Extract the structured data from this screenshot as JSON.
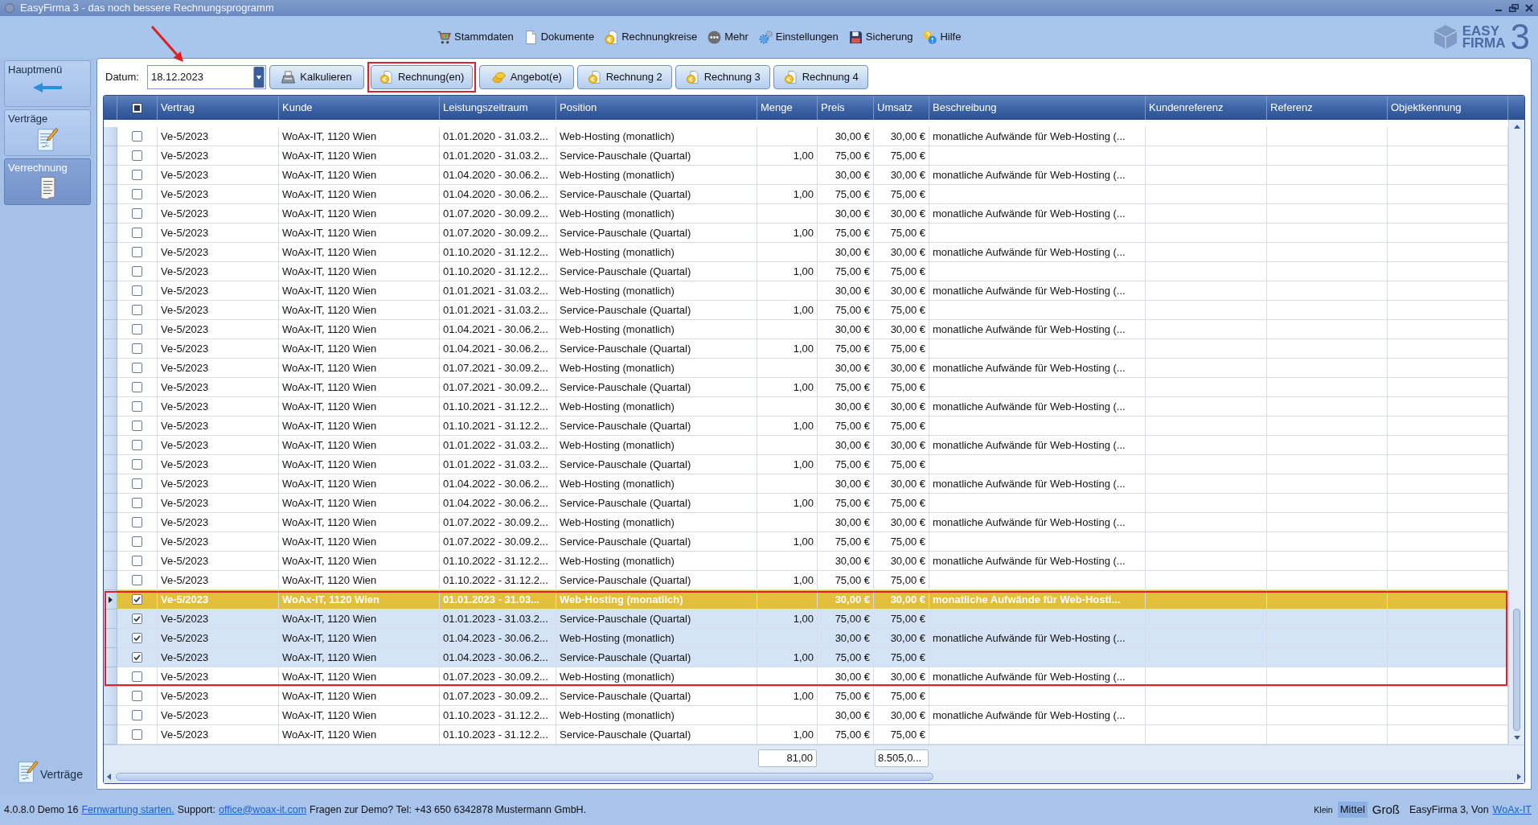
{
  "window": {
    "title": "EasyFirma 3 - das noch bessere Rechnungsprogramm"
  },
  "menu": [
    {
      "label": "Stammdaten"
    },
    {
      "label": "Dokumente"
    },
    {
      "label": "Rechnungkreise"
    },
    {
      "label": "Mehr"
    },
    {
      "label": "Einstellungen"
    },
    {
      "label": "Sicherung"
    },
    {
      "label": "Hilfe"
    }
  ],
  "logo": {
    "line1": "EASY",
    "line2": "FIRMA",
    "numeral": "3"
  },
  "sidebar": {
    "items": [
      {
        "label": "Hauptmenü",
        "selected": false
      },
      {
        "label": "Verträge",
        "selected": false
      },
      {
        "label": "Verrechnung",
        "selected": true
      }
    ],
    "footer_link": "Verträge"
  },
  "toolbar": {
    "date": {
      "label": "Datum:",
      "value": "18.12.2023",
      "marked": true
    },
    "buttons": [
      {
        "label": "Kalkulieren",
        "kind": "calculate",
        "marked": false
      },
      {
        "label": "Rechnung(en)",
        "kind": "invoice",
        "marked": true
      },
      {
        "label": "Angebot(e)",
        "kind": "quote",
        "marked": false
      },
      {
        "label": "Rechnung 2",
        "kind": "invoice",
        "marked": false
      },
      {
        "label": "Rechnung 3",
        "kind": "invoice",
        "marked": false
      },
      {
        "label": "Rechnung 4",
        "kind": "invoice",
        "marked": false
      }
    ]
  },
  "table": {
    "header_checkbox": {
      "indeterminate": true
    },
    "columns": [
      "Vertrag",
      "Kunde",
      "Leistungszeitraum",
      "Position",
      "Menge",
      "Preis",
      "Umsatz",
      "Beschreibung",
      "Kundenreferenz",
      "Referenz",
      "Objektkennung"
    ],
    "row_groups": [
      {
        "highlighted": false,
        "rows": [
          {
            "vertrag": "Ve-5/2023",
            "kunde": "WoAx-IT, 1120 Wien",
            "leistungszeitraum": "01.01.2020 - 31.03.2...",
            "position": "Web-Hosting (monatlich)",
            "preis": "30,00 €",
            "umsatz": "30,00 €",
            "beschreibung": "monatliche Aufwände für Web-Hosting (...",
            "checked": false,
            "selected": false,
            "focused": false
          },
          {
            "vertrag": "Ve-5/2023",
            "kunde": "WoAx-IT, 1120 Wien",
            "leistungszeitraum": "01.01.2020 - 31.03.2...",
            "position": "Service-Pauschale (Quartal)",
            "menge": "1,00",
            "preis": "75,00 €",
            "umsatz": "75,00 €",
            "checked": false,
            "selected": false,
            "focused": false
          },
          {
            "vertrag": "Ve-5/2023",
            "kunde": "WoAx-IT, 1120 Wien",
            "leistungszeitraum": "01.04.2020 - 30.06.2...",
            "position": "Web-Hosting (monatlich)",
            "preis": "30,00 €",
            "umsatz": "30,00 €",
            "beschreibung": "monatliche Aufwände für Web-Hosting (...",
            "checked": false,
            "selected": false,
            "focused": false
          },
          {
            "vertrag": "Ve-5/2023",
            "kunde": "WoAx-IT, 1120 Wien",
            "leistungszeitraum": "01.04.2020 - 30.06.2...",
            "position": "Service-Pauschale (Quartal)",
            "menge": "1,00",
            "preis": "75,00 €",
            "umsatz": "75,00 €",
            "checked": false,
            "selected": false,
            "focused": false
          },
          {
            "vertrag": "Ve-5/2023",
            "kunde": "WoAx-IT, 1120 Wien",
            "leistungszeitraum": "01.07.2020 - 30.09.2...",
            "position": "Web-Hosting (monatlich)",
            "preis": "30,00 €",
            "umsatz": "30,00 €",
            "beschreibung": "monatliche Aufwände für Web-Hosting (...",
            "checked": false,
            "selected": false,
            "focused": false
          },
          {
            "vertrag": "Ve-5/2023",
            "kunde": "WoAx-IT, 1120 Wien",
            "leistungszeitraum": "01.07.2020 - 30.09.2...",
            "position": "Service-Pauschale (Quartal)",
            "menge": "1,00",
            "preis": "75,00 €",
            "umsatz": "75,00 €",
            "checked": false,
            "selected": false,
            "focused": false
          },
          {
            "vertrag": "Ve-5/2023",
            "kunde": "WoAx-IT, 1120 Wien",
            "leistungszeitraum": "01.10.2020 - 31.12.2...",
            "position": "Web-Hosting (monatlich)",
            "preis": "30,00 €",
            "umsatz": "30,00 €",
            "beschreibung": "monatliche Aufwände für Web-Hosting (...",
            "checked": false,
            "selected": false,
            "focused": false
          },
          {
            "vertrag": "Ve-5/2023",
            "kunde": "WoAx-IT, 1120 Wien",
            "leistungszeitraum": "01.10.2020 - 31.12.2...",
            "position": "Service-Pauschale (Quartal)",
            "menge": "1,00",
            "preis": "75,00 €",
            "umsatz": "75,00 €",
            "checked": false,
            "selected": false,
            "focused": false
          },
          {
            "vertrag": "Ve-5/2023",
            "kunde": "WoAx-IT, 1120 Wien",
            "leistungszeitraum": "01.01.2021 - 31.03.2...",
            "position": "Web-Hosting (monatlich)",
            "preis": "30,00 €",
            "umsatz": "30,00 €",
            "beschreibung": "monatliche Aufwände für Web-Hosting (...",
            "checked": false,
            "selected": false,
            "focused": false
          },
          {
            "vertrag": "Ve-5/2023",
            "kunde": "WoAx-IT, 1120 Wien",
            "leistungszeitraum": "01.01.2021 - 31.03.2...",
            "position": "Service-Pauschale (Quartal)",
            "menge": "1,00",
            "preis": "75,00 €",
            "umsatz": "75,00 €",
            "checked": false,
            "selected": false,
            "focused": false
          },
          {
            "vertrag": "Ve-5/2023",
            "kunde": "WoAx-IT, 1120 Wien",
            "leistungszeitraum": "01.04.2021 - 30.06.2...",
            "position": "Web-Hosting (monatlich)",
            "preis": "30,00 €",
            "umsatz": "30,00 €",
            "beschreibung": "monatliche Aufwände für Web-Hosting (...",
            "checked": false,
            "selected": false,
            "focused": false
          },
          {
            "vertrag": "Ve-5/2023",
            "kunde": "WoAx-IT, 1120 Wien",
            "leistungszeitraum": "01.04.2021 - 30.06.2...",
            "position": "Service-Pauschale (Quartal)",
            "menge": "1,00",
            "preis": "75,00 €",
            "umsatz": "75,00 €",
            "checked": false,
            "selected": false,
            "focused": false
          },
          {
            "vertrag": "Ve-5/2023",
            "kunde": "WoAx-IT, 1120 Wien",
            "leistungszeitraum": "01.07.2021 - 30.09.2...",
            "position": "Web-Hosting (monatlich)",
            "preis": "30,00 €",
            "umsatz": "30,00 €",
            "beschreibung": "monatliche Aufwände für Web-Hosting (...",
            "checked": false,
            "selected": false,
            "focused": false
          },
          {
            "vertrag": "Ve-5/2023",
            "kunde": "WoAx-IT, 1120 Wien",
            "leistungszeitraum": "01.07.2021 - 30.09.2...",
            "position": "Service-Pauschale (Quartal)",
            "menge": "1,00",
            "preis": "75,00 €",
            "umsatz": "75,00 €",
            "checked": false,
            "selected": false,
            "focused": false
          },
          {
            "vertrag": "Ve-5/2023",
            "kunde": "WoAx-IT, 1120 Wien",
            "leistungszeitraum": "01.10.2021 - 31.12.2...",
            "position": "Web-Hosting (monatlich)",
            "preis": "30,00 €",
            "umsatz": "30,00 €",
            "beschreibung": "monatliche Aufwände für Web-Hosting (...",
            "checked": false,
            "selected": false,
            "focused": false
          },
          {
            "vertrag": "Ve-5/2023",
            "kunde": "WoAx-IT, 1120 Wien",
            "leistungszeitraum": "01.10.2021 - 31.12.2...",
            "position": "Service-Pauschale (Quartal)",
            "menge": "1,00",
            "preis": "75,00 €",
            "umsatz": "75,00 €",
            "checked": false,
            "selected": false,
            "focused": false
          },
          {
            "vertrag": "Ve-5/2023",
            "kunde": "WoAx-IT, 1120 Wien",
            "leistungszeitraum": "01.01.2022 - 31.03.2...",
            "position": "Web-Hosting (monatlich)",
            "preis": "30,00 €",
            "umsatz": "30,00 €",
            "beschreibung": "monatliche Aufwände für Web-Hosting (...",
            "checked": false,
            "selected": false,
            "focused": false
          },
          {
            "vertrag": "Ve-5/2023",
            "kunde": "WoAx-IT, 1120 Wien",
            "leistungszeitraum": "01.01.2022 - 31.03.2...",
            "position": "Service-Pauschale (Quartal)",
            "menge": "1,00",
            "preis": "75,00 €",
            "umsatz": "75,00 €",
            "checked": false,
            "selected": false,
            "focused": false
          },
          {
            "vertrag": "Ve-5/2023",
            "kunde": "WoAx-IT, 1120 Wien",
            "leistungszeitraum": "01.04.2022 - 30.06.2...",
            "position": "Web-Hosting (monatlich)",
            "preis": "30,00 €",
            "umsatz": "30,00 €",
            "beschreibung": "monatliche Aufwände für Web-Hosting (...",
            "checked": false,
            "selected": false,
            "focused": false
          },
          {
            "vertrag": "Ve-5/2023",
            "kunde": "WoAx-IT, 1120 Wien",
            "leistungszeitraum": "01.04.2022 - 30.06.2...",
            "position": "Service-Pauschale (Quartal)",
            "menge": "1,00",
            "preis": "75,00 €",
            "umsatz": "75,00 €",
            "checked": false,
            "selected": false,
            "focused": false
          },
          {
            "vertrag": "Ve-5/2023",
            "kunde": "WoAx-IT, 1120 Wien",
            "leistungszeitraum": "01.07.2022 - 30.09.2...",
            "position": "Web-Hosting (monatlich)",
            "preis": "30,00 €",
            "umsatz": "30,00 €",
            "beschreibung": "monatliche Aufwände für Web-Hosting (...",
            "checked": false,
            "selected": false,
            "focused": false
          },
          {
            "vertrag": "Ve-5/2023",
            "kunde": "WoAx-IT, 1120 Wien",
            "leistungszeitraum": "01.07.2022 - 30.09.2...",
            "position": "Service-Pauschale (Quartal)",
            "menge": "1,00",
            "preis": "75,00 €",
            "umsatz": "75,00 €",
            "checked": false,
            "selected": false,
            "focused": false
          },
          {
            "vertrag": "Ve-5/2023",
            "kunde": "WoAx-IT, 1120 Wien",
            "leistungszeitraum": "01.10.2022 - 31.12.2...",
            "position": "Web-Hosting (monatlich)",
            "preis": "30,00 €",
            "umsatz": "30,00 €",
            "beschreibung": "monatliche Aufwände für Web-Hosting (...",
            "checked": false,
            "selected": false,
            "focused": false
          },
          {
            "vertrag": "Ve-5/2023",
            "kunde": "WoAx-IT, 1120 Wien",
            "leistungszeitraum": "01.10.2022 - 31.12.2...",
            "position": "Service-Pauschale (Quartal)",
            "menge": "1,00",
            "preis": "75,00 €",
            "umsatz": "75,00 €",
            "checked": false,
            "selected": false,
            "focused": false
          }
        ]
      },
      {
        "highlighted": true,
        "rows": [
          {
            "vertrag": "Ve-5/2023",
            "kunde": "WoAx-IT, 1120 Wien",
            "leistungszeitraum": "01.01.2023 - 31.03...",
            "position": "Web-Hosting (monatlich)",
            "preis": "30,00 €",
            "umsatz": "30,00 €",
            "beschreibung": "monatliche Aufwände für Web-Hosti...",
            "checked": true,
            "selected": true,
            "focused": true
          },
          {
            "vertrag": "Ve-5/2023",
            "kunde": "WoAx-IT, 1120 Wien",
            "leistungszeitraum": "01.01.2023 - 31.03.2...",
            "position": "Service-Pauschale (Quartal)",
            "menge": "1,00",
            "preis": "75,00 €",
            "umsatz": "75,00 €",
            "checked": true,
            "selected": true,
            "focused": false
          },
          {
            "vertrag": "Ve-5/2023",
            "kunde": "WoAx-IT, 1120 Wien",
            "leistungszeitraum": "01.04.2023 - 30.06.2...",
            "position": "Web-Hosting (monatlich)",
            "preis": "30,00 €",
            "umsatz": "30,00 €",
            "beschreibung": "monatliche Aufwände für Web-Hosting (...",
            "checked": true,
            "selected": true,
            "focused": false
          },
          {
            "vertrag": "Ve-5/2023",
            "kunde": "WoAx-IT, 1120 Wien",
            "leistungszeitraum": "01.04.2023 - 30.06.2...",
            "position": "Service-Pauschale (Quartal)",
            "menge": "1,00",
            "preis": "75,00 €",
            "umsatz": "75,00 €",
            "checked": true,
            "selected": true,
            "focused": false
          },
          {
            "vertrag": "Ve-5/2023",
            "kunde": "WoAx-IT, 1120 Wien",
            "leistungszeitraum": "01.07.2023 - 30.09.2...",
            "position": "Web-Hosting (monatlich)",
            "preis": "30,00 €",
            "umsatz": "30,00 €",
            "beschreibung": "monatliche Aufwände für Web-Hosting (...",
            "checked": false,
            "selected": false,
            "focused": false
          }
        ]
      },
      {
        "highlighted": false,
        "rows": [
          {
            "vertrag": "Ve-5/2023",
            "kunde": "WoAx-IT, 1120 Wien",
            "leistungszeitraum": "01.07.2023 - 30.09.2...",
            "position": "Service-Pauschale (Quartal)",
            "menge": "1,00",
            "preis": "75,00 €",
            "umsatz": "75,00 €",
            "checked": false,
            "selected": false,
            "focused": false
          },
          {
            "vertrag": "Ve-5/2023",
            "kunde": "WoAx-IT, 1120 Wien",
            "leistungszeitraum": "01.10.2023 - 31.12.2...",
            "position": "Web-Hosting (monatlich)",
            "preis": "30,00 €",
            "umsatz": "30,00 €",
            "beschreibung": "monatliche Aufwände für Web-Hosting (...",
            "checked": false,
            "selected": false,
            "focused": false
          },
          {
            "vertrag": "Ve-5/2023",
            "kunde": "WoAx-IT, 1120 Wien",
            "leistungszeitraum": "01.10.2023 - 31.12.2...",
            "position": "Service-Pauschale (Quartal)",
            "menge": "1,00",
            "preis": "75,00 €",
            "umsatz": "75,00 €",
            "checked": false,
            "selected": false,
            "focused": false
          }
        ]
      }
    ],
    "totals": {
      "menge": "81,00",
      "umsatz": "8.505,0..."
    }
  },
  "status_bar": {
    "version": "4.0.8.0 Demo 16",
    "remote_link": "Fernwartung starten.",
    "support_label": "Support:",
    "support_email": "office@woax-it.com",
    "info": "Fragen zur Demo? Tel: +43 650 6342878 Mustermann GmbH.",
    "sizes": [
      {
        "label": "Klein",
        "selected": false
      },
      {
        "label": "Mittel",
        "selected": true
      },
      {
        "label": "Groß",
        "selected": false
      }
    ],
    "credit": "EasyFirma 3, Von",
    "credit_link": "WoAx-IT"
  }
}
